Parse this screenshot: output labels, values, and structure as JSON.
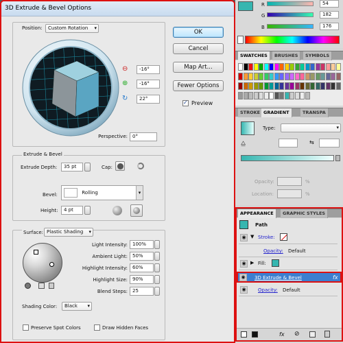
{
  "dialog": {
    "title": "3D Extrude & Bevel Options",
    "position_label": "Position:",
    "position_value": "Custom Rotation",
    "rotation": {
      "x": "-16°",
      "y": "-16°",
      "z": "22°"
    },
    "perspective_label": "Perspective:",
    "perspective_value": "0°",
    "buttons": {
      "ok": "OK",
      "cancel": "Cancel",
      "map_art": "Map Art...",
      "fewer_options": "Fewer Options"
    },
    "preview_label": "Preview",
    "preview_checked": true,
    "extrude_section": "Extrude & Bevel",
    "extrude_depth_label": "Extrude Depth:",
    "extrude_depth_value": "35 pt",
    "cap_label": "Cap:",
    "bevel_label": "Bevel:",
    "bevel_value": "Rolling",
    "height_label": "Height:",
    "height_value": "4 pt",
    "surface_label": "Surface:",
    "surface_value": "Plastic Shading",
    "light_intensity_label": "Light Intensity:",
    "light_intensity_value": "100%",
    "ambient_light_label": "Ambient Light:",
    "ambient_light_value": "50%",
    "highlight_intensity_label": "Highlight Intensity:",
    "highlight_intensity_value": "60%",
    "highlight_size_label": "Highlight Size:",
    "highlight_size_value": "90%",
    "blend_steps_label": "Blend Steps:",
    "blend_steps_value": "25",
    "shading_color_label": "Shading Color:",
    "shading_color_value": "Black",
    "preserve_spot_label": "Preserve Spot Colors",
    "draw_hidden_label": "Draw Hidden Faces"
  },
  "color_panel": {
    "r_label": "R",
    "r_value": "54",
    "g_label": "G",
    "g_value": "182",
    "b_label": "B",
    "b_value": "176"
  },
  "swatches_tabs": [
    "SWATCHES",
    "BRUSHES",
    "SYMBOLS"
  ],
  "gradient_tabs": [
    "STROKE",
    "GRADIENT",
    "TRANSPA"
  ],
  "gradient": {
    "type_label": "Type:",
    "opacity_label": "Opacity:",
    "location_label": "Location:",
    "percent": "%"
  },
  "appearance_tabs": [
    "APPEARANCE",
    "GRAPHIC STYLES"
  ],
  "appearance": {
    "path_label": "Path",
    "stroke_label": "Stroke:",
    "opacity_label": "Opacity:",
    "opacity_value": "Default",
    "fill_label": "Fill:",
    "effect_label": "3D Extrude & Bevel",
    "effect_fx": "fx",
    "opacity2_label": "Opacity:",
    "opacity2_value": "Default",
    "footer_fx": "fx"
  },
  "colors": {
    "accent": "#36b6b0",
    "highlight_border": "#dd1111",
    "selection": "#3c7fd0"
  }
}
